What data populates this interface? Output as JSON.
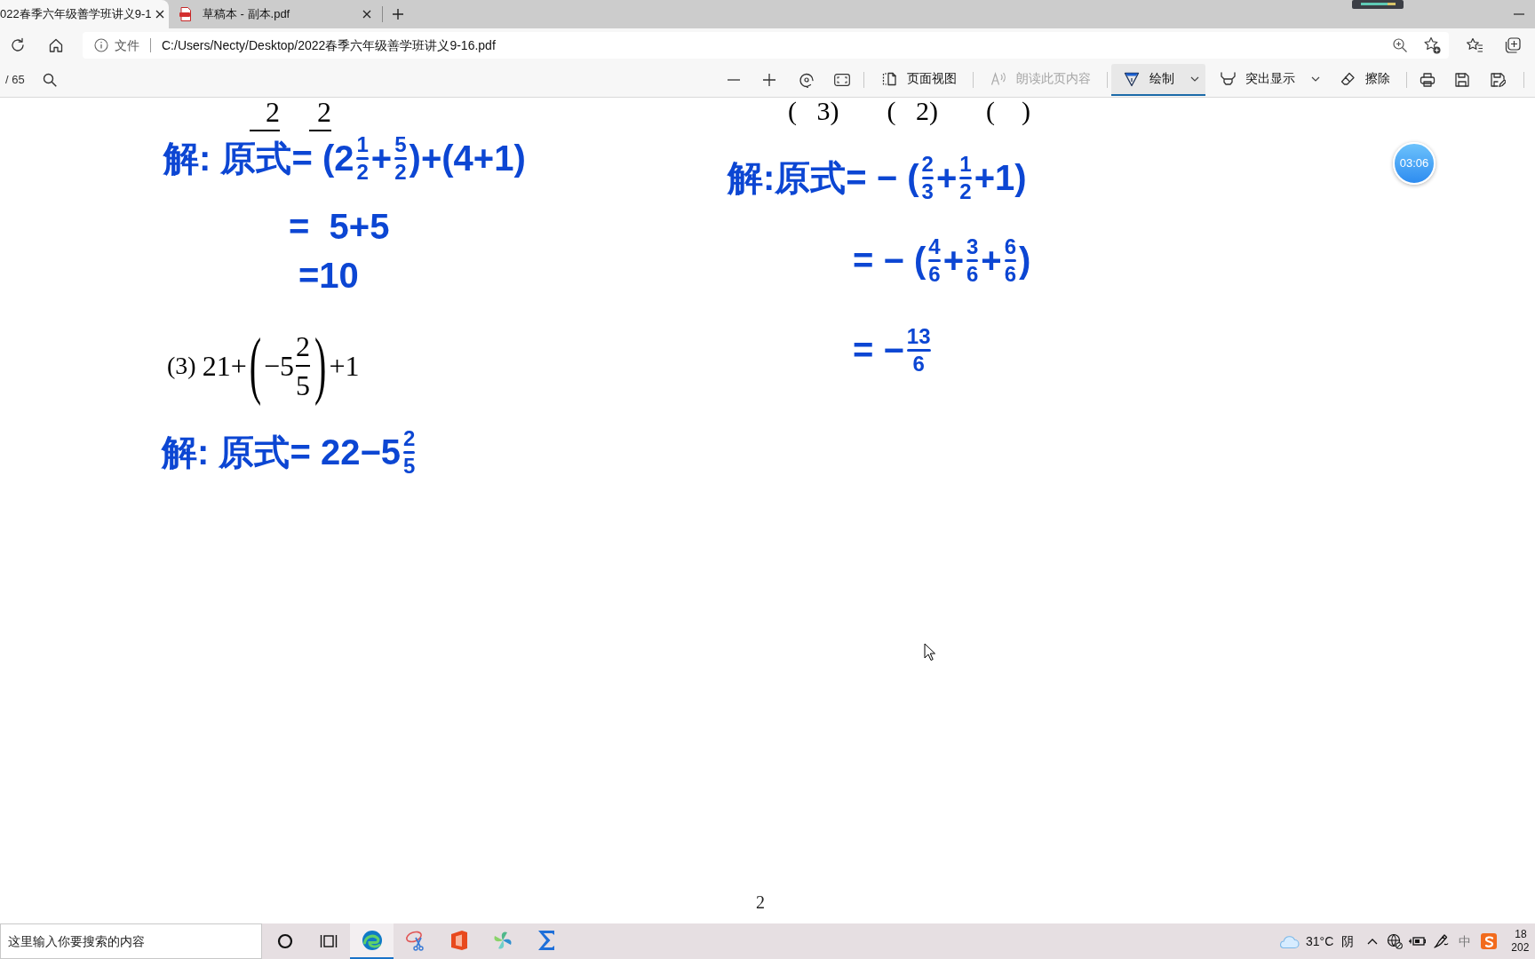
{
  "tabs": [
    {
      "title": "022春季六年级善学班讲义9-1",
      "selected": true
    },
    {
      "title": "草稿本 - 副本.pdf",
      "selected": false
    }
  ],
  "address_bar": {
    "site_info": "文件",
    "url": "C:/Users/Necty/Desktop/2022春季六年级善学班讲义9-16.pdf"
  },
  "pdf_toolbar": {
    "page_count": "/ 65",
    "tools": [
      {
        "label": "页面视图",
        "selected": false,
        "disabled": false,
        "dropdown": false
      },
      {
        "label": "朗读此页内容",
        "selected": false,
        "disabled": true,
        "dropdown": false
      },
      {
        "label": "绘制",
        "selected": true,
        "disabled": false,
        "dropdown": true
      },
      {
        "label": "突出显示",
        "selected": false,
        "disabled": false,
        "dropdown": true
      },
      {
        "label": "擦除",
        "selected": false,
        "disabled": false,
        "dropdown": false
      }
    ]
  },
  "document": {
    "left_column": [
      {
        "kind": "fragment",
        "texts": [
          "2",
          "2"
        ],
        "underlined": true
      },
      {
        "kind": "handwriting",
        "parts": [
          {
            "kind": "text",
            "text": "解: 原式= (2"
          },
          {
            "kind": "frac",
            "num": "1",
            "den": "2"
          },
          {
            "kind": "text",
            "text": "+"
          },
          {
            "kind": "frac",
            "num": "5",
            "den": "2"
          },
          {
            "kind": "text",
            "text": ")+(4+1)"
          }
        ]
      },
      {
        "kind": "handwriting",
        "parts": [
          {
            "kind": "text",
            "text": "=  5+5"
          }
        ]
      },
      {
        "kind": "handwriting",
        "parts": [
          {
            "kind": "text",
            "text": "=10"
          }
        ]
      },
      {
        "kind": "printed",
        "label": "(3)",
        "parts": [
          {
            "kind": "text",
            "text": "21+"
          },
          {
            "kind": "group",
            "open": "(",
            "close": ")",
            "parts": [
              {
                "kind": "text",
                "text": "−5"
              },
              {
                "kind": "frac",
                "num": "2",
                "den": "5"
              }
            ]
          },
          {
            "kind": "text",
            "text": "+1"
          }
        ]
      },
      {
        "kind": "handwriting",
        "parts": [
          {
            "kind": "text",
            "text": "解: 原式= 22−5"
          },
          {
            "kind": "frac",
            "num": "2",
            "den": "5"
          }
        ]
      }
    ],
    "right_column": [
      {
        "kind": "fragment",
        "texts": [
          "(   3)",
          "(   2)",
          "(    )"
        ],
        "underlined": false
      },
      {
        "kind": "handwriting",
        "parts": [
          {
            "kind": "text",
            "text": "解:原式= − ("
          },
          {
            "kind": "frac",
            "num": "2",
            "den": "3"
          },
          {
            "kind": "text",
            "text": "+"
          },
          {
            "kind": "frac",
            "num": "1",
            "den": "2"
          },
          {
            "kind": "text",
            "text": "+1)"
          }
        ]
      },
      {
        "kind": "handwriting",
        "parts": [
          {
            "kind": "text",
            "text": "= − ("
          },
          {
            "kind": "frac",
            "num": "4",
            "den": "6"
          },
          {
            "kind": "text",
            "text": "+"
          },
          {
            "kind": "frac",
            "num": "3",
            "den": "6"
          },
          {
            "kind": "text",
            "text": "+"
          },
          {
            "kind": "frac",
            "num": "6",
            "den": "6"
          },
          {
            "kind": "text",
            "text": ")"
          }
        ]
      },
      {
        "kind": "handwriting",
        "parts": [
          {
            "kind": "text",
            "text": "= −"
          },
          {
            "kind": "frac",
            "num": "13",
            "den": "6"
          }
        ]
      }
    ],
    "page_number": "2"
  },
  "timer": "03:06",
  "taskbar": {
    "search_placeholder": "这里输入你要搜索的内容",
    "apps": [
      {
        "selected": true
      },
      {
        "selected": false
      },
      {
        "selected": false
      },
      {
        "selected": false
      },
      {
        "selected": false
      }
    ],
    "weather": {
      "temperature": "31°C",
      "condition": "阴"
    },
    "input_method": "中",
    "clock": {
      "time": "18",
      "date": "202"
    }
  }
}
